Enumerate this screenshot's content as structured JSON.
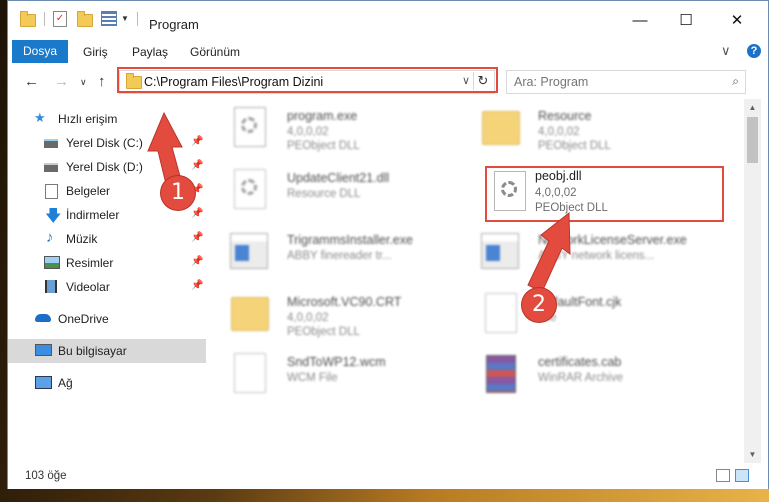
{
  "window": {
    "title": "Program",
    "minimize_glyph": "—",
    "maximize_glyph": "☐",
    "close_glyph": "✕"
  },
  "ribbon": {
    "tabs": [
      "Dosya",
      "Giriş",
      "Paylaş",
      "Görünüm"
    ],
    "expand_glyph": "∨",
    "help_glyph": "?"
  },
  "nav": {
    "back_glyph": "←",
    "forward_glyph": "→",
    "recent_glyph": "∨",
    "up_glyph": "↑",
    "address": "C:\\Program Files\\Program Dizini",
    "dropdown_glyph": "∨",
    "refresh_glyph": "↻",
    "search_placeholder": "Ara: Program",
    "search_glyph": "⌕"
  },
  "sidebar": {
    "items": [
      {
        "label": "Hızlı erişim",
        "icon": "star-icon",
        "pinned": false
      },
      {
        "label": "Yerel Disk (C:)",
        "icon": "drive-icon",
        "pinned": true
      },
      {
        "label": "Yerel Disk (D:)",
        "icon": "drive-icon",
        "pinned": true
      },
      {
        "label": "Belgeler",
        "icon": "documents-icon",
        "pinned": true
      },
      {
        "label": "İndirmeler",
        "icon": "download-icon",
        "pinned": true
      },
      {
        "label": "Müzik",
        "icon": "music-icon",
        "pinned": true
      },
      {
        "label": "Resimler",
        "icon": "pictures-icon",
        "pinned": true
      },
      {
        "label": "Videolar",
        "icon": "video-icon",
        "pinned": true
      },
      {
        "label": "OneDrive",
        "icon": "cloud-icon",
        "pinned": false
      },
      {
        "label": "Bu bilgisayar",
        "icon": "computer-icon",
        "pinned": false,
        "selected": true
      },
      {
        "label": "Ağ",
        "icon": "network-icon",
        "pinned": false
      }
    ],
    "pin_glyph": "📌"
  },
  "files": [
    {
      "name": "program.exe",
      "line1": "4,0,0,02",
      "line2": "PEObject DLL",
      "icon": "exe-gear-icon"
    },
    {
      "name": "Resource",
      "line1": "4,0,0,02",
      "line2": "PEObject DLL",
      "icon": "folder-icon"
    },
    {
      "name": "UpdateClient21.dll",
      "line1": "Resource DLL",
      "line2": "",
      "icon": "dll-file-icon"
    },
    {
      "name": "peobj.dll",
      "line1": "4,0,0,02",
      "line2": "PEObject DLL",
      "icon": "dll-file-icon"
    },
    {
      "name": "TrigrammsInstaller.exe",
      "line1": "ABBY finereader tr...",
      "line2": "",
      "icon": "exe-window-icon"
    },
    {
      "name": "NetworkLicenseServer.exe",
      "line1": "ABBY network licens...",
      "line2": "",
      "icon": "exe-window-icon"
    },
    {
      "name": "Microsoft.VC90.CRT",
      "line1": "4,0,0,02",
      "line2": "PEObject DLL",
      "icon": "folder-icon"
    },
    {
      "name": "DefaultFont.cjk",
      "line1": "File",
      "line2": "",
      "icon": "blank-file-icon"
    },
    {
      "name": "SndToWP12.wcm",
      "line1": "WCM File",
      "line2": "",
      "icon": "blank-file-icon"
    },
    {
      "name": "certificates.cab",
      "line1": "WinRAR Archive",
      "line2": "",
      "icon": "winrar-icon"
    }
  ],
  "status": {
    "count": "103 öğe"
  },
  "annotations": {
    "step1": "1",
    "step2": "2",
    "color": "#e34b3f"
  }
}
